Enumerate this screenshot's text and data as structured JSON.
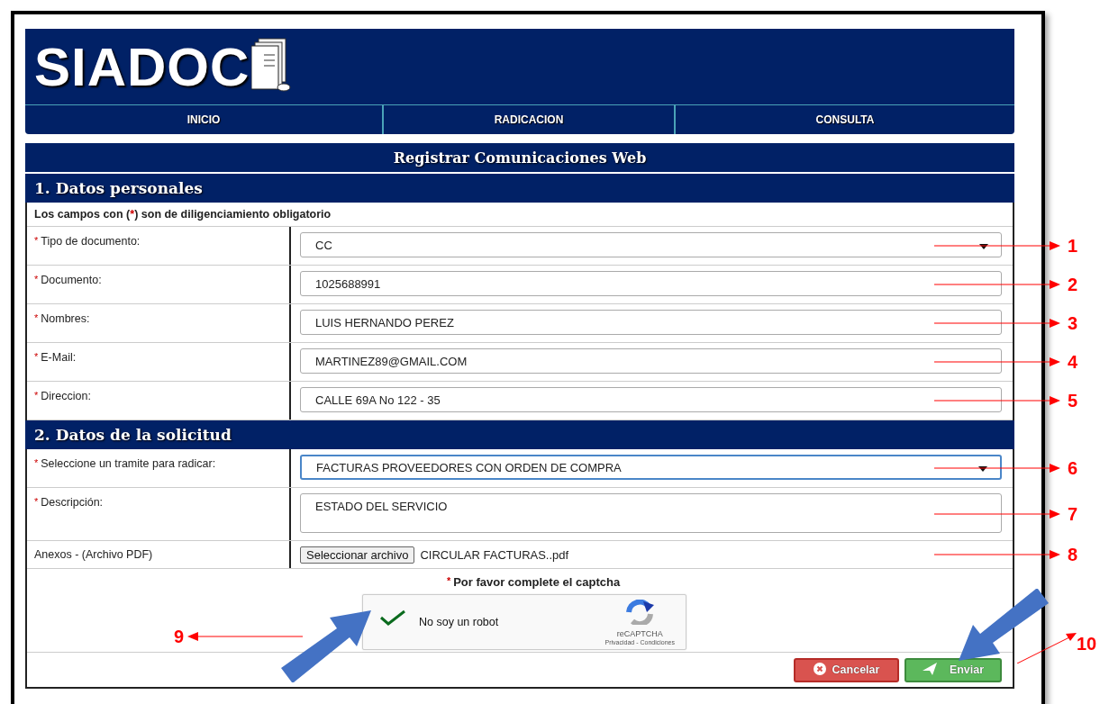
{
  "logo": {
    "text": "SIADOC"
  },
  "nav": [
    {
      "label": "INICIO",
      "selected": false
    },
    {
      "label": "RADICACION",
      "selected": false
    },
    {
      "label": "CONSULTA",
      "selected": false
    }
  ],
  "page_title": "Registrar Comunicaciones Web",
  "sections": [
    {
      "title": "1. Datos personales",
      "note": "Los campos con (*) son de diligenciamiento obligatorio",
      "fields": [
        {
          "label": "Tipo de documento:",
          "marker": "*",
          "kind": "select",
          "value": "CC",
          "focused": false,
          "callout": "1"
        },
        {
          "label": "Documento:",
          "marker": "*",
          "kind": "text",
          "value": "1025688991",
          "focused": false,
          "callout": "2"
        },
        {
          "label": "Nombres:",
          "marker": "*",
          "kind": "text",
          "value": "LUIS HERNANDO PEREZ",
          "focused": false,
          "callout": "3"
        },
        {
          "label": "E-Mail:",
          "marker": "*",
          "kind": "text",
          "value": "MARTINEZ89@GMAIL.COM",
          "focused": false,
          "callout": "4"
        },
        {
          "label": "Direccion:",
          "marker": "*",
          "kind": "text",
          "value": "CALLE 69A No 122 - 35",
          "focused": false,
          "callout": "5"
        }
      ]
    },
    {
      "title": "2. Datos de la solicitud",
      "fields": [
        {
          "label": "Seleccione un tramite para radicar:",
          "marker": "*",
          "kind": "select",
          "value": "FACTURAS PROVEEDORES CON ORDEN DE COMPRA",
          "focused": true,
          "callout": "6"
        },
        {
          "label": "Descripción:",
          "marker": "*",
          "kind": "textarea",
          "value": "ESTADO DEL SERVICIO",
          "focused": false,
          "callout": "7"
        },
        {
          "label": "Anexos - (Archivo PDF)",
          "kind": "file",
          "button": "Seleccionar archivo",
          "value": "CIRCULAR FACTURAS..pdf",
          "callout": "8"
        }
      ]
    }
  ],
  "captcha": {
    "prompt": "Por favor complete el captcha",
    "marker": "*",
    "label": "No soy un robot",
    "checked": true,
    "brand": "reCAPTCHA",
    "links": "Privacidad - Condiciones",
    "callout": "9",
    "highlighted": true
  },
  "buttons": [
    {
      "kind": "cancel",
      "label": "Cancelar",
      "highlighted": false
    },
    {
      "kind": "send",
      "label": "Enviar",
      "highlighted": true,
      "callout": "10"
    }
  ]
}
